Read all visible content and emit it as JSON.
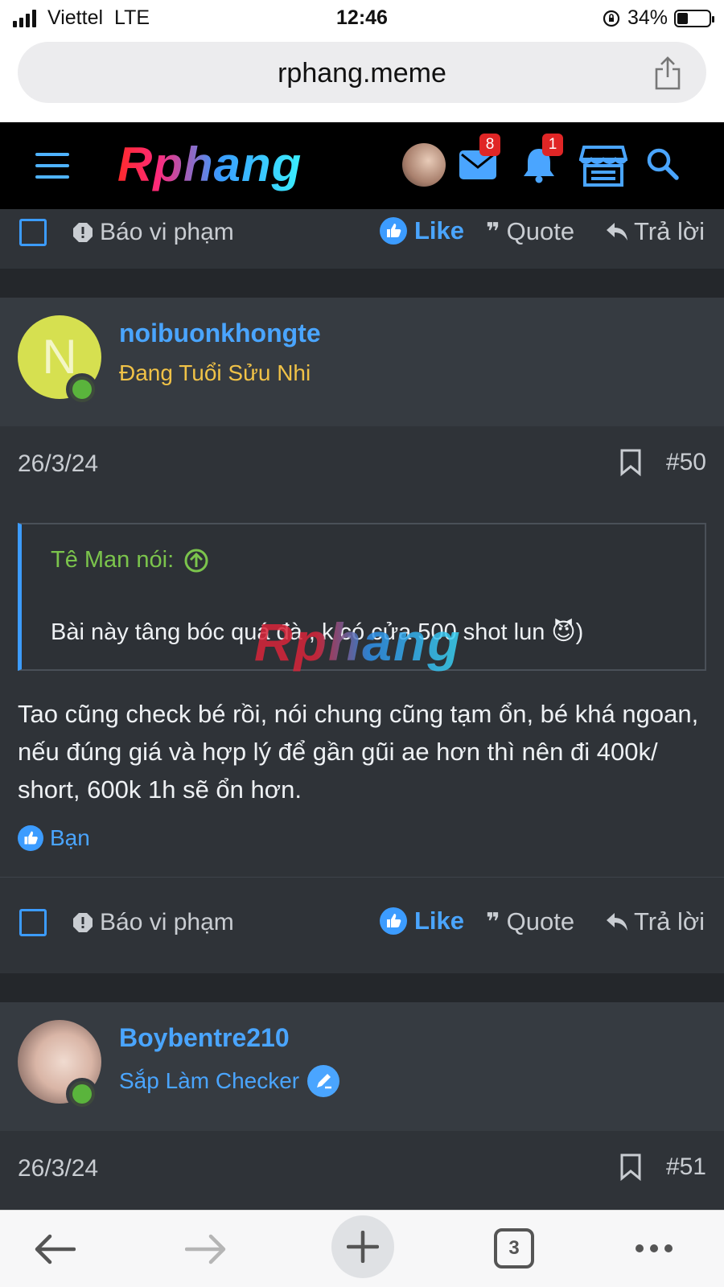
{
  "status_bar": {
    "carrier": "Viettel",
    "network": "LTE",
    "time": "12:46",
    "battery": "34%",
    "battery_level": 0.34
  },
  "browser": {
    "url": "rphang.meme",
    "tabs_count": "3"
  },
  "site_header": {
    "logo_text": "Rphang",
    "messages_badge": "8",
    "alerts_badge": "1"
  },
  "actions": {
    "report": "Báo vi phạm",
    "like": "Like",
    "quote": "Quote",
    "reply": "Trả lời"
  },
  "posts": [
    {
      "avatar_letter": "N",
      "username": "noibuonkhongte",
      "user_title": "Đang Tuổi Sửu Nhi",
      "user_title_color": "#f0c247",
      "date": "26/3/24",
      "number": "#50",
      "quote_author": "Tê Man nói:",
      "quote_text": "Bài này tâng bóc quá đà , k có cửa 500 shot lun 😈)",
      "body": "Tao cũng check bé rồi, nói chung cũng tạm ổn, bé khá ngoan, nếu đúng giá và hợp lý để gần gũi ae hơn thì nên đi 400k/ short, 600k 1h sẽ ổn hơn.",
      "reaction_user": "Bạn"
    },
    {
      "username": "Boybentre210",
      "user_title": "Sắp Làm Checker",
      "user_title_color": "#4aa5ff",
      "date": "26/3/24",
      "number": "#51"
    }
  ],
  "watermark": "Rphang",
  "colors": {
    "accent": "#4aa5ff",
    "background": "#2a2e33",
    "online": "#5ab43c",
    "badge": "#e02626"
  },
  "icons": [
    "signal-icon",
    "orientation-lock-icon",
    "battery-icon",
    "share-icon",
    "hamburger-icon",
    "mail-icon",
    "bell-icon",
    "store-icon",
    "search-icon",
    "report-icon",
    "like-icon",
    "quote-icon",
    "reply-icon",
    "bookmark-icon",
    "up-arrow-icon",
    "edit-badge-icon",
    "back-icon",
    "forward-icon",
    "plus-icon",
    "tabs-icon",
    "more-icon"
  ]
}
